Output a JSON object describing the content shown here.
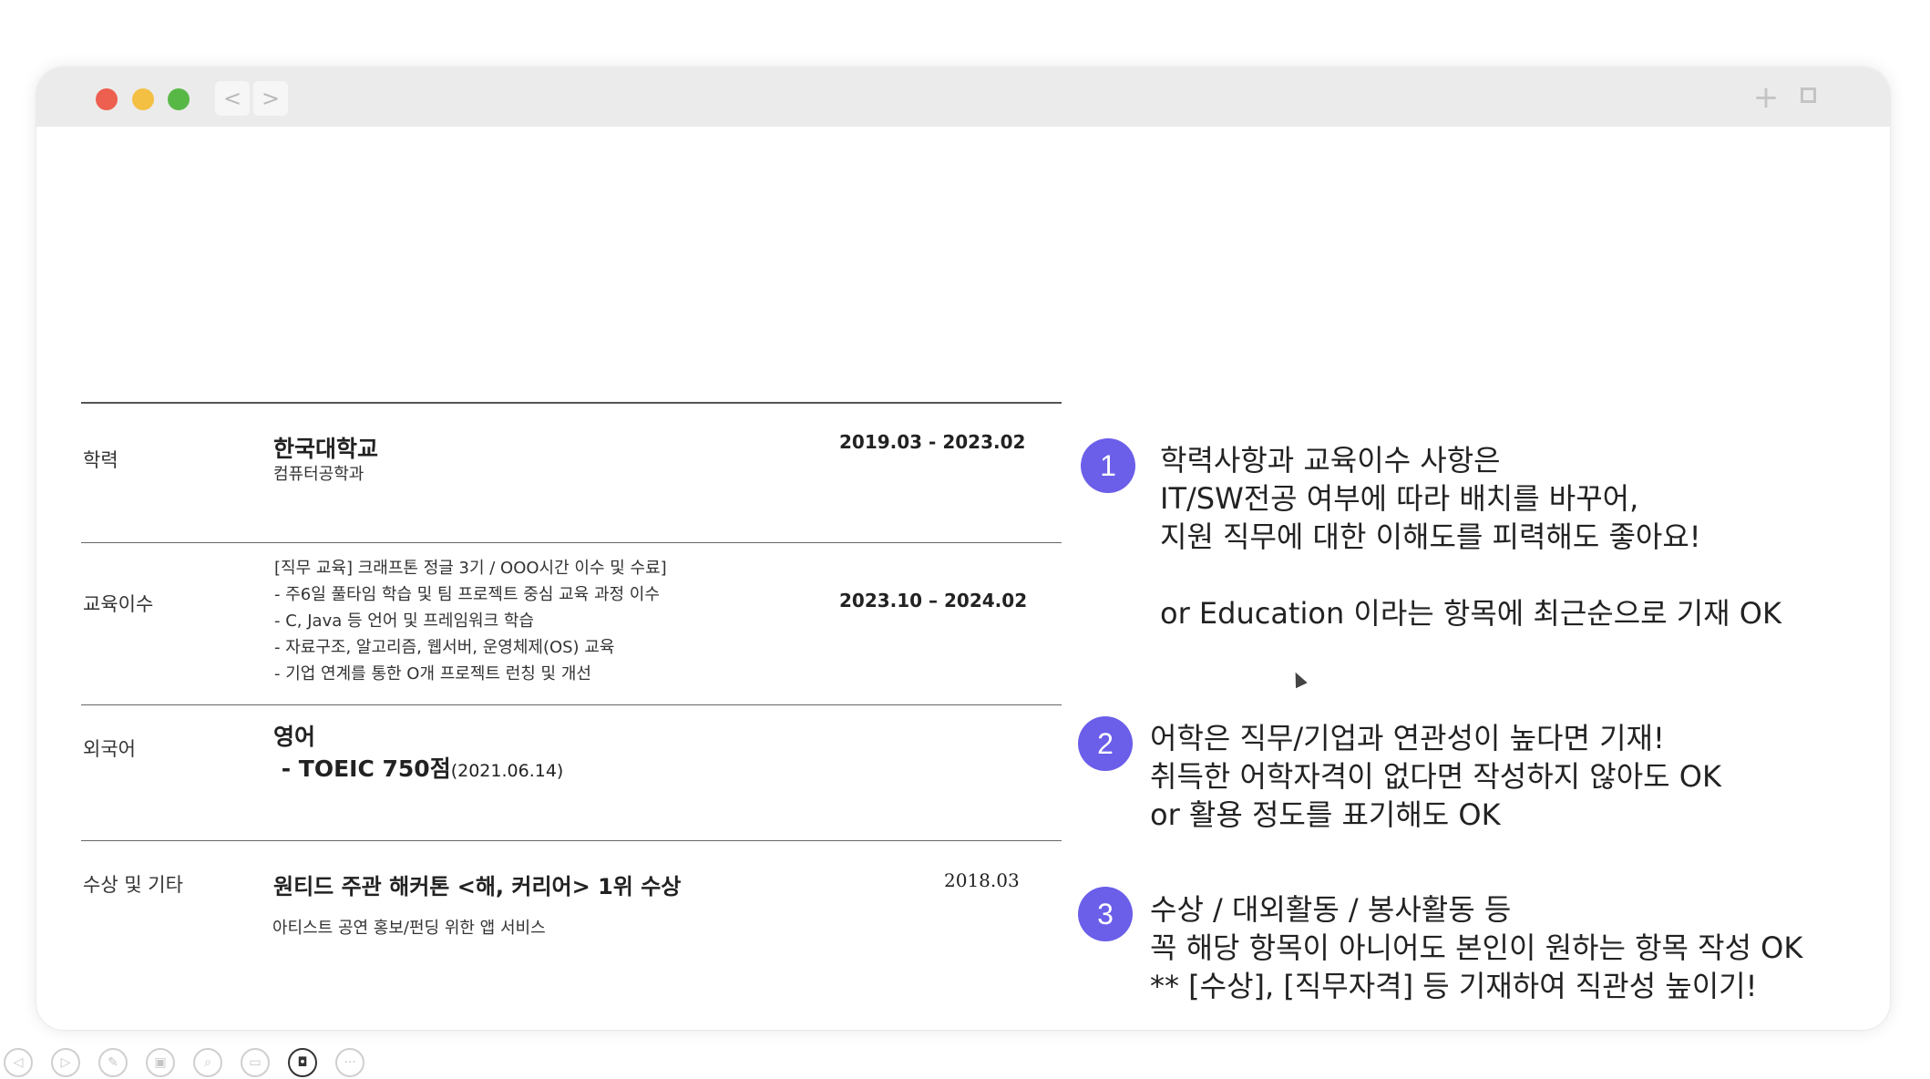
{
  "window": {
    "traffic_lights": {
      "close": "#ed5f4f",
      "minimize": "#f3c044",
      "zoom": "#58b846"
    },
    "nav": {
      "back": "<",
      "forward": ">"
    },
    "new_tab": "+"
  },
  "resume": {
    "education": {
      "label": "학력",
      "school": "한국대학교",
      "major": "컴퓨터공학과",
      "period": "2019.03 - 2023.02"
    },
    "training": {
      "label": "교육이수",
      "lines": [
        "[직무 교육] 크래프톤 정글 3기 / OOO시간 이수 및 수료]",
        "- 주6일 풀타임 학습 및 팀 프로젝트 중심 교육 과정 이수",
        "- C, Java 등 언어 및 프레임워크 학습",
        "- 자료구조, 알고리즘, 웹서버, 운영체제(OS) 교육",
        "- 기업 연계를 통한 O개 프로젝트 런칭 및 개선"
      ],
      "period": "2023.10 – 2024.02"
    },
    "language": {
      "label": "외국어",
      "name": "영어",
      "test": " - TOEIC 750점",
      "test_date": "(2021.06.14)"
    },
    "awards": {
      "label": "수상 및 기타",
      "title": "원티드 주관 해커톤 <해, 커리어> 1위 수상",
      "desc": "아티스트 공연 홍보/펀딩 위한 앱 서비스",
      "date": "2018.03"
    }
  },
  "notes": [
    {
      "number": "1",
      "lines": [
        "학력사항과 교육이수 사항은",
        "IT/SW전공 여부에 따라 배치를 바꾸어,",
        "지원 직무에 대한 이해도를 피력해도 좋아요!",
        "",
        "or Education 이라는 항목에 최근순으로 기재 OK"
      ]
    },
    {
      "number": "2",
      "lines": [
        "어학은 직무/기업과 연관성이 높다면 기재!",
        "취득한 어학자격이 없다면 작성하지 않아도 OK",
        "or 활용 정도를 표기해도 OK"
      ]
    },
    {
      "number": "3",
      "lines": [
        "수상 / 대외활동 / 봉사활동 등",
        "꼭 해당 항목이 아니어도 본인이 원하는 항목 작성 OK",
        "** [수상], [직무자격] 등 기재하여 직관성 높이기!"
      ]
    }
  ],
  "accent_color": "#6b5ee9",
  "player_toolbar": {
    "icons": [
      "prev-icon",
      "play-icon",
      "pen-icon",
      "slides-icon",
      "zoom-icon",
      "subtitles-icon",
      "camera-icon",
      "more-icon"
    ],
    "active": "camera-icon"
  }
}
